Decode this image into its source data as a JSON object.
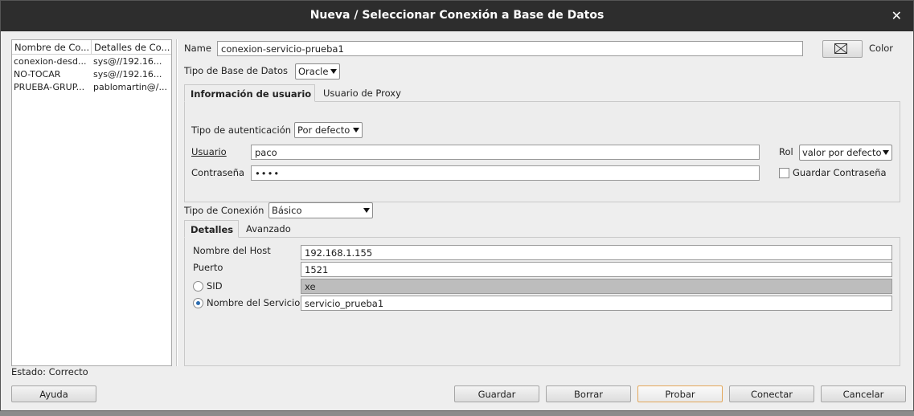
{
  "window": {
    "title": "Nueva / Seleccionar Conexión a Base de Datos",
    "close_icon": "close-icon"
  },
  "connections": {
    "headers": [
      "Nombre de Co...",
      "Detalles de Co..."
    ],
    "rows": [
      [
        "conexion-desd...",
        "sys@//192.16..."
      ],
      [
        "NO-TOCAR",
        "sys@//192.16..."
      ],
      [
        "PRUEBA-GRUP...",
        "pablomartin@/..."
      ]
    ]
  },
  "status": {
    "label": "Estado: Correcto"
  },
  "form": {
    "name_label": "Name",
    "name_value": "conexion-servicio-prueba1",
    "color_label": "Color",
    "db_type_label": "Tipo de Base de Datos",
    "db_type_value": "Oracle",
    "user_tabs": [
      "Información de usuario",
      "Usuario de Proxy"
    ],
    "auth_label": "Tipo de autenticación",
    "auth_value": "Por defecto",
    "user_label": "Usuario",
    "user_value": "paco",
    "password_label": "Contraseña",
    "password_value": "••••",
    "role_label": "Rol",
    "role_value": "valor por defecto",
    "save_password_label": "Guardar Contraseña",
    "conn_type_label": "Tipo de Conexión",
    "conn_type_value": "Básico",
    "detail_tabs": [
      "Detalles",
      "Avanzado"
    ],
    "host_label": "Nombre del Host",
    "host_value": "192.168.1.155",
    "port_label": "Puerto",
    "port_value": "1521",
    "sid_label": "SID",
    "sid_value": "xe",
    "service_label": "Nombre del Servicio",
    "service_value": "servicio_prueba1"
  },
  "buttons": {
    "help": "Ayuda",
    "save": "Guardar",
    "delete": "Borrar",
    "test": "Probar",
    "connect": "Conectar",
    "cancel": "Cancelar"
  }
}
